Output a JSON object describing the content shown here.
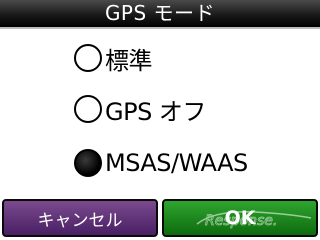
{
  "header": {
    "title": "GPS モード"
  },
  "options": [
    {
      "label": "標準",
      "selected": false
    },
    {
      "label": "GPS オフ",
      "selected": false
    },
    {
      "label": "MSAS/WAAS",
      "selected": true
    }
  ],
  "buttons": {
    "cancel_label": "キャンセル",
    "ok_label": "OK"
  },
  "watermark": {
    "text": "Response."
  },
  "colors": {
    "title_bar": "#000000",
    "cancel_button": "#5a2a73",
    "ok_button": "#1a8a1a",
    "background": "#ffffff"
  }
}
